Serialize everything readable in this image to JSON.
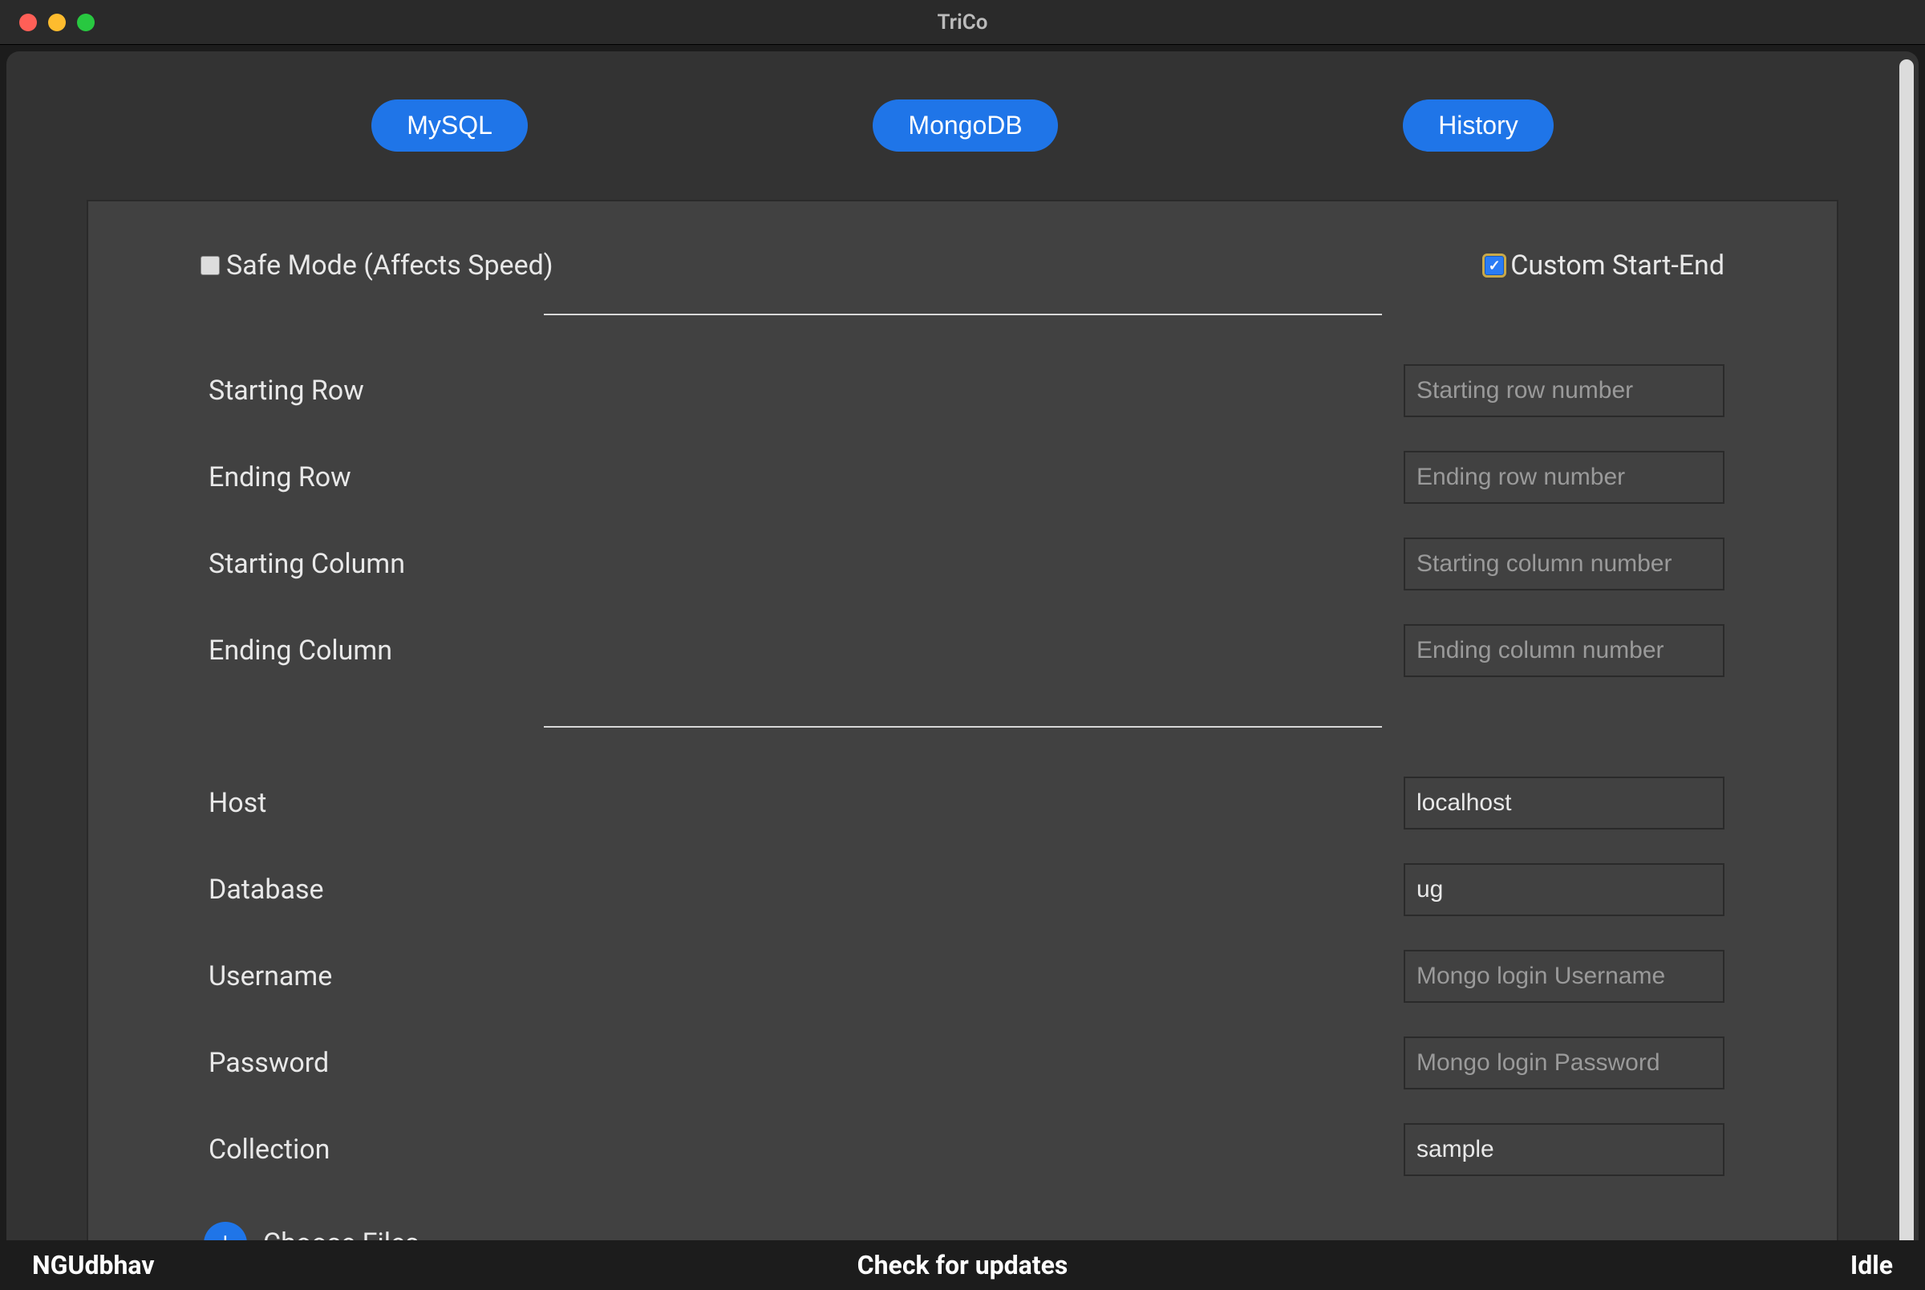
{
  "window": {
    "title": "TriCo"
  },
  "tabs": {
    "mysql": "MySQL",
    "mongodb": "MongoDB",
    "history": "History"
  },
  "checkboxes": {
    "safe_mode_label": "Safe Mode (Affects Speed)",
    "safe_mode_checked": false,
    "custom_start_end_label": "Custom Start-End",
    "custom_start_end_checked": true
  },
  "range_fields": [
    {
      "label": "Starting Row",
      "placeholder": "Starting row number",
      "value": ""
    },
    {
      "label": "Ending Row",
      "placeholder": "Ending row number",
      "value": ""
    },
    {
      "label": "Starting Column",
      "placeholder": "Starting column number",
      "value": ""
    },
    {
      "label": "Ending Column",
      "placeholder": "Ending column number",
      "value": ""
    }
  ],
  "db_fields": [
    {
      "label": "Host",
      "placeholder": "",
      "value": "localhost"
    },
    {
      "label": "Database",
      "placeholder": "",
      "value": "ug"
    },
    {
      "label": "Username",
      "placeholder": "Mongo login Username",
      "value": ""
    },
    {
      "label": "Password",
      "placeholder": "Mongo login Password",
      "value": ""
    },
    {
      "label": "Collection",
      "placeholder": "",
      "value": "sample"
    }
  ],
  "file_section": {
    "choose_files_label": "Choose Files",
    "plus_glyph": "+"
  },
  "status_bar": {
    "left": "NGUdbhav",
    "center": "Check for updates",
    "right": "Idle"
  }
}
